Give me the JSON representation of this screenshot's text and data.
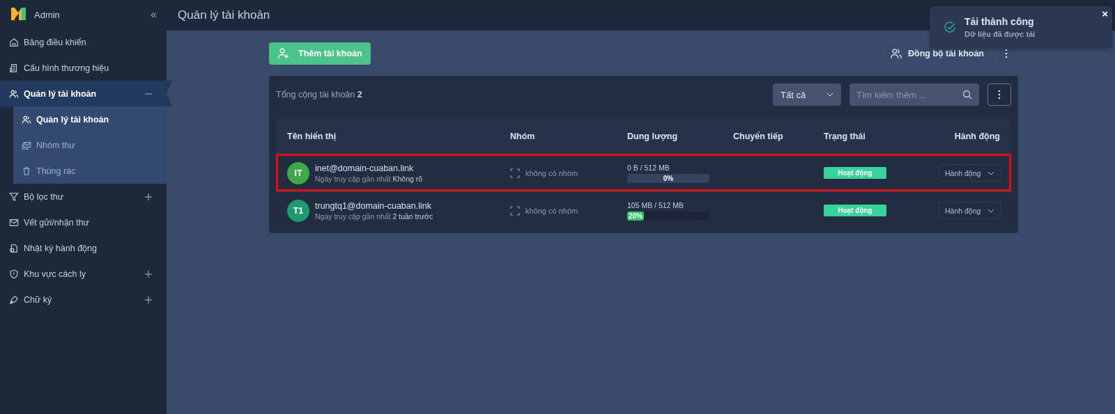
{
  "sidebar": {
    "brand": "Admin",
    "collapse_glyph": "«",
    "items": [
      {
        "label": "Bảng điều khiển",
        "kind": "link",
        "selected": false
      },
      {
        "label": "Cấu hình thương hiệu",
        "kind": "link",
        "selected": false
      },
      {
        "label": "Quản lý tài khoản",
        "kind": "group",
        "selected": true,
        "expanded": true,
        "children": [
          {
            "label": "Quản lý tài khoản",
            "selected": true
          },
          {
            "label": "Nhóm thư",
            "selected": false
          },
          {
            "label": "Thùng rác",
            "selected": false
          }
        ]
      },
      {
        "label": "Bộ lọc thư",
        "kind": "group",
        "selected": false,
        "expanded": false
      },
      {
        "label": "Vết gửi/nhận thư",
        "kind": "link",
        "selected": false
      },
      {
        "label": "Nhật ký hành động",
        "kind": "link",
        "selected": false
      },
      {
        "label": "Khu vực cách ly",
        "kind": "group",
        "selected": false,
        "expanded": false
      },
      {
        "label": "Chữ ký",
        "kind": "group",
        "selected": false,
        "expanded": false
      }
    ]
  },
  "header": {
    "title": "Quản lý tài khoản"
  },
  "toolbar": {
    "add_button": "Thêm tài khoản",
    "sync_button": "Đồng bộ tài khoản"
  },
  "table_card": {
    "total_label": "Tổng cộng tài khoản",
    "total_count": "2",
    "filter": "Tất cả",
    "search": {
      "placeholder": "Tìm kiếm thêm ..."
    },
    "columns": [
      "Tên hiển thị",
      "Nhóm",
      "Dung lượng",
      "Chuyển tiếp",
      "Trạng thái",
      "Hành động"
    ],
    "rows": [
      {
        "initials": "IT",
        "color": "#3fa84a",
        "email": "inet@domain-cuaban.link",
        "last_access_label": "Ngày truy cập gần nhất",
        "last_access": "Không rõ",
        "group": "không có nhóm",
        "usage": "0 B / 512 MB",
        "level": 0,
        "percent": "0%",
        "status": "Hoạt động",
        "action": "Hành động",
        "highlighted": true
      },
      {
        "initials": "T1",
        "color": "#1e9a72",
        "email": "trungtq1@domain-cuaban.link",
        "last_access_label": "Ngày truy cập gần nhất",
        "last_access": "2 tuần trước",
        "group": "không có nhóm",
        "usage": "105 MB / 512 MB",
        "level": 0.2,
        "percent": "20%",
        "status": "Hoạt động",
        "action": "Hành động",
        "highlighted": false
      }
    ]
  },
  "toast": {
    "title": "Tải thành công",
    "message": "Dữ liệu đã được tải",
    "close_glyph": "×"
  }
}
